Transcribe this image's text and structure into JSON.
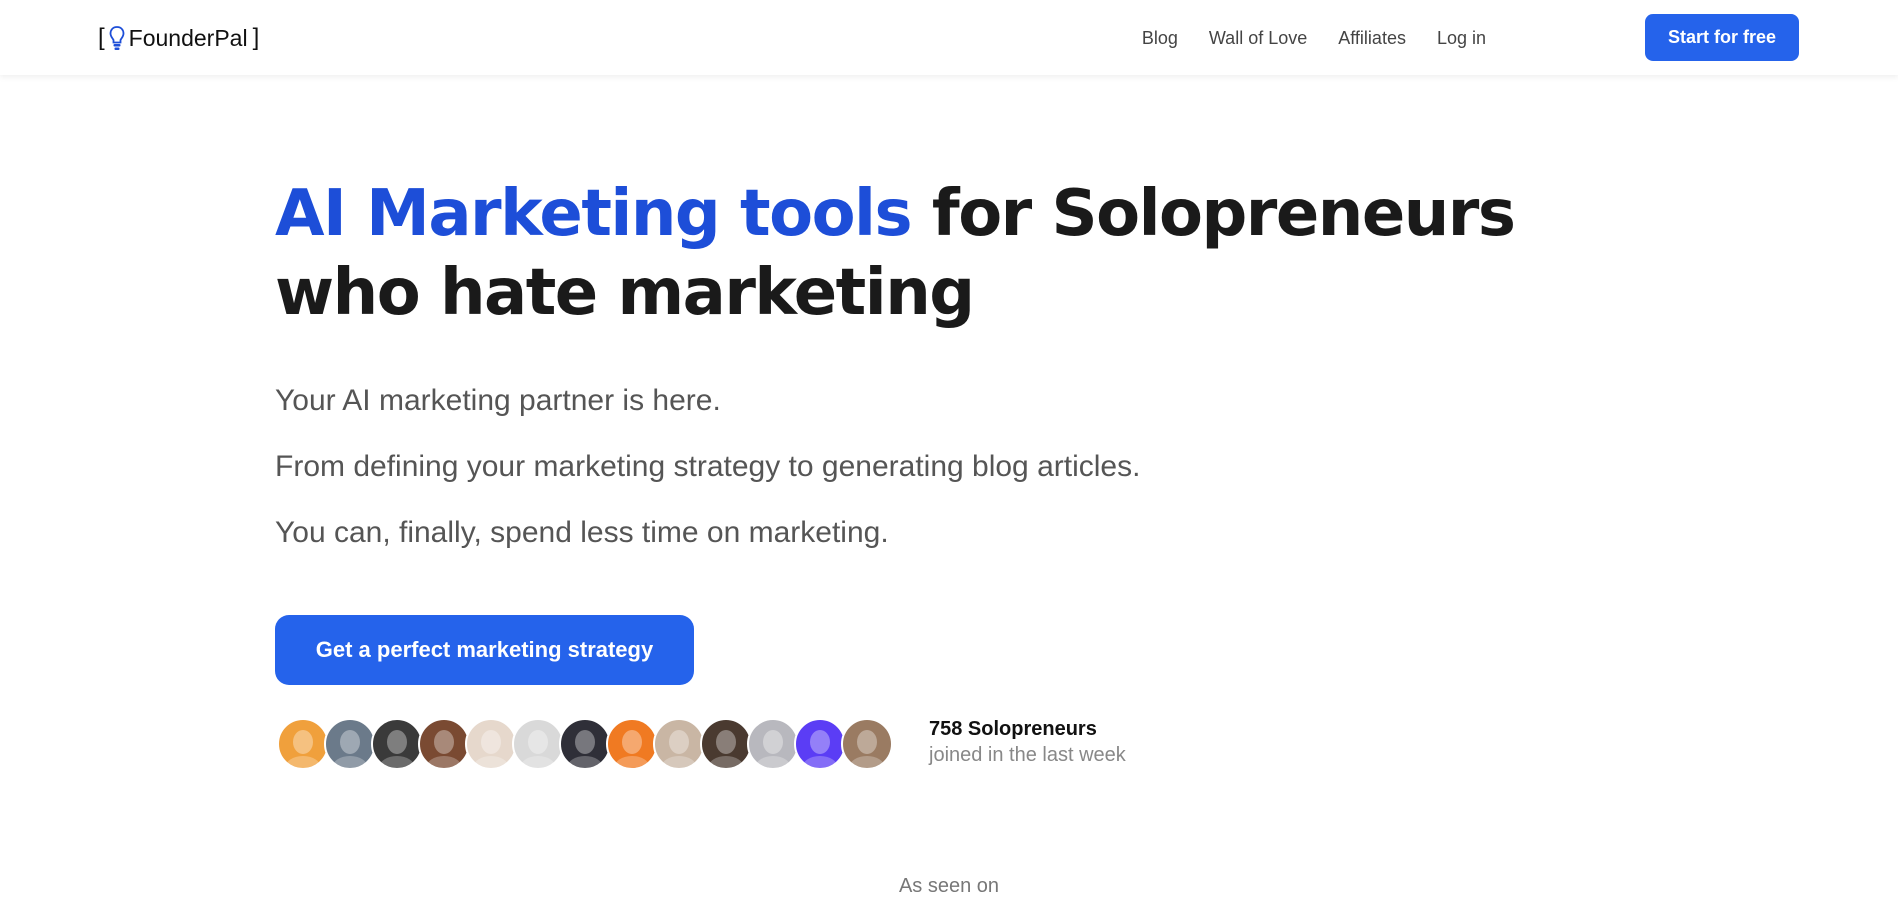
{
  "header": {
    "logo_name": "FounderPal",
    "logo_bracket_open": "[",
    "logo_bracket_close": "]",
    "nav": [
      "Blog",
      "Wall of Love",
      "Affiliates",
      "Log in"
    ],
    "cta_label": "Start for free"
  },
  "hero": {
    "headline_accent": "AI Marketing tools",
    "headline_rest": "for Solopreneurs",
    "headline_line2": "who hate marketing",
    "subs": [
      "Your AI marketing partner is here.",
      "From defining your marketing strategy to generating blog articles.",
      "You can, finally, spend less time on marketing."
    ],
    "cta_label": "Get a perfect marketing strategy"
  },
  "social_proof": {
    "count_text": "758 Solopreneurs",
    "subtext": "joined in the last week",
    "avatar_colors": [
      "#f0a03c",
      "#6b7a8a",
      "#3a3a3a",
      "#7a4a32",
      "#e6d8cc",
      "#d9d9d9",
      "#2f2f38",
      "#f07a22",
      "#c9b6a4",
      "#4a3a30",
      "#b8b8be",
      "#5b3df5",
      "#9a7b62"
    ]
  },
  "as_seen_on": "As seen on",
  "colors": {
    "accent": "#2563eb",
    "headline_accent": "#1d4ed8"
  }
}
